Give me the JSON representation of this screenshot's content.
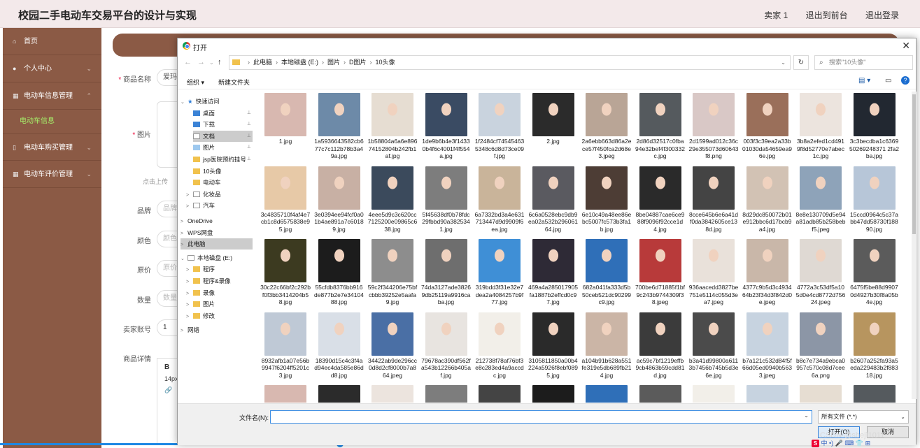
{
  "app": {
    "title": "校园二手电动车交易平台的设计与实现",
    "nav": [
      "卖家 1",
      "退出到前台",
      "退出登录"
    ]
  },
  "sidebar": {
    "items": [
      {
        "label": "首页",
        "icon": "home-icon"
      },
      {
        "label": "个人中心",
        "icon": "user-icon"
      },
      {
        "label": "电动车信息管理",
        "icon": "grid-icon"
      },
      {
        "label": "电动车信息",
        "sub": true
      },
      {
        "label": "电动车购买管理",
        "icon": "doc-icon"
      },
      {
        "label": "电动车评价管理",
        "icon": "grid-icon"
      }
    ]
  },
  "form": {
    "name_label": "商品名称",
    "name_value": "爱玛",
    "image_label": "图片",
    "upload_hint": "点击上传",
    "brand_label": "品牌",
    "brand_placeholder": "品牌",
    "color_label": "颜色",
    "color_placeholder": "颜色",
    "price_label": "原价",
    "price_placeholder": "原价",
    "qty_label": "数量",
    "qty_placeholder": "数量",
    "seller_label": "卖家账号",
    "seller_value": "1",
    "detail_label": "商品详情",
    "editor_bold": "B",
    "editor_size": "14px"
  },
  "dialog": {
    "title": "打开",
    "close": "✕",
    "address": [
      "此电脑",
      "本地磁盘 (E:)",
      "图片",
      "D图片",
      "10头像"
    ],
    "search_placeholder": "搜索\"10头像\"",
    "organize": "组织 ▾",
    "new_folder": "新建文件夹",
    "help": "?",
    "tree": [
      {
        "label": "快速访问",
        "kind": "star",
        "x": 4,
        "arrow": "⌄"
      },
      {
        "label": "桌面",
        "kind": "blue",
        "x": 22,
        "pin": true
      },
      {
        "label": "下载",
        "kind": "blue",
        "x": 22,
        "pin": true
      },
      {
        "label": "文档",
        "kind": "white",
        "x": 22,
        "pin": true,
        "sel": true
      },
      {
        "label": "图片",
        "kind": "pic",
        "x": 22,
        "pin": true
      },
      {
        "label": "jsp医院预约挂号",
        "kind": "folder",
        "x": 22,
        "pin": true
      },
      {
        "label": "10头像",
        "kind": "folder",
        "x": 22
      },
      {
        "label": "电动车",
        "kind": "folder",
        "x": 22
      },
      {
        "label": "化妆品",
        "kind": "white",
        "x": 12,
        "arrow": ">"
      },
      {
        "label": "汽车",
        "kind": "white",
        "x": 12,
        "arrow": ">"
      },
      {
        "label": "OneDrive",
        "kind": "none",
        "x": 4,
        "arrow": ">"
      },
      {
        "label": "WPS网盘",
        "kind": "none",
        "x": 4,
        "arrow": ">"
      },
      {
        "label": "此电脑",
        "kind": "none",
        "x": 4,
        "arrow": ">",
        "sel": true
      },
      {
        "label": "本地磁盘 (E:)",
        "kind": "white",
        "x": 4,
        "arrow": "⌄"
      },
      {
        "label": "程序",
        "kind": "folder",
        "x": 12,
        "arrow": ">"
      },
      {
        "label": "程序&录像",
        "kind": "folder",
        "x": 12,
        "arrow": ">"
      },
      {
        "label": "录像",
        "kind": "folder",
        "x": 12,
        "arrow": ">"
      },
      {
        "label": "图片",
        "kind": "folder",
        "x": 12,
        "arrow": ">"
      },
      {
        "label": "修改",
        "kind": "folder",
        "x": 12,
        "arrow": ">"
      },
      {
        "label": "网络",
        "kind": "none",
        "x": 4,
        "arrow": ">"
      }
    ],
    "files": [
      "1.jpg",
      "1a5936643582cb677c7c112b78b3a49a.jpg",
      "1b58804a6a6e89674152804b242fb1af.jpg",
      "1de9b6b4e3f14330b4f6c4001f4f554a.jpg",
      "1f2484cf745454635348c6d8d73ce09f.jpg",
      "2.jpg",
      "2a6ebb663d86a2ece57f450fca2d68e3.jpeg",
      "2d86d32517c0fba94e32bef4f300332c.jpg",
      "2d1599ad012c36c29e355073d60643f8.png",
      "003f3c39ea2a33b01030da54659ea96e.jpg",
      "3b8a2efed1cd4919f8d52770e7abec1c.jpg",
      "3c3becdba1c636950269248371 2fa2ba.jpg",
      "3c4835710f4af4e7cb1c8d6575838e95.jpg",
      "3e0394ee94fcf0a01b4ae891a7c60189.jpg",
      "4eee5d9c3c620cc7125200e09865c638.jpg",
      "5f45638df0b78fdc29fbbd90a3825341.jpg",
      "6a7332bd3a4e631713447d9d9909f6ea.jpg",
      "6c6a0528ebc9db9ea02a532b29606164.jpg",
      "6e10c49a48ee86ebc5007fc573b3fa1b.jpg",
      "8be04887cae6ce988f9096f92cce1d4.jpg",
      "8cce645b6e6a41df0da3842605ce138d.jpg",
      "8d29dc850072b01e912bbc6d17bcb9a4.jpg",
      "8e8e130709d5e94a81adb85b258bebf5.jpeg",
      "15ccd0964c5c37abb47dd58730f18890.jpg",
      "30c22c66bf2c292bf0f3bb3414204b58.jpg",
      "55cfdb8376bb916de877b2e7e3410488.jpg",
      "59c2f344206e75bfcbbb39252e5aafa9.jpg",
      "74da3127ade38269db25119a9916caba.jpg",
      "319bdd3f31e32e7dea2a4084257b9f77.jpg",
      "469a4a285017905fa1887b2effcd0c97.jpg",
      "682a041fa333d5b50ceb521dc90299c9.jpg",
      "700be6d71885f1bf9c243b9744309f38.jpeg",
      "936aacedd3827be751e5114c055d3ea7.jpeg",
      "4377c9b5d3c493464b23f34d3f842d0e.jpeg",
      "4772a3c53df5a105d0e4cd8772d75624.jpeg",
      "6475f5be88d99070d4927b30f8a05b4e.jpg",
      "8932afb1a07e56b9947f6204ff5201c3.jpg",
      "18390d15c4c3f4ad94ec4da585e86dd8.jpg",
      "34422ab9de296cc0d8d2cf8000b7a864.jpeg",
      "79678ac390df562fa543b12266b405af.jpg",
      "212738f78af76bf3e8c283ed4a9accdc.jpg",
      "3105811850a00b4224a5926f8ebf0895.jpg",
      "a104b91b628a551fe319e5db689fb214.jpg",
      "ac59c7bf1219effb9cb4863b59cdd81d.jpg",
      "b3a41d99800a6113b7456b745b5d3e6e.jpg",
      "b7a121c532d84f5f66d05ed0940b5633.jpeg",
      "b8c7e734a9ebca0957c570c08d7cee6a.png",
      "b2607a252fa93a5eda229483b2f88318.jpg"
    ],
    "filename_label": "文件名(N):",
    "filetype": "所有文件 (*.*)",
    "open_button": "打开(O)",
    "cancel_button": "取消"
  },
  "watermark": "CSDN @shejì1011",
  "ime": "中"
}
